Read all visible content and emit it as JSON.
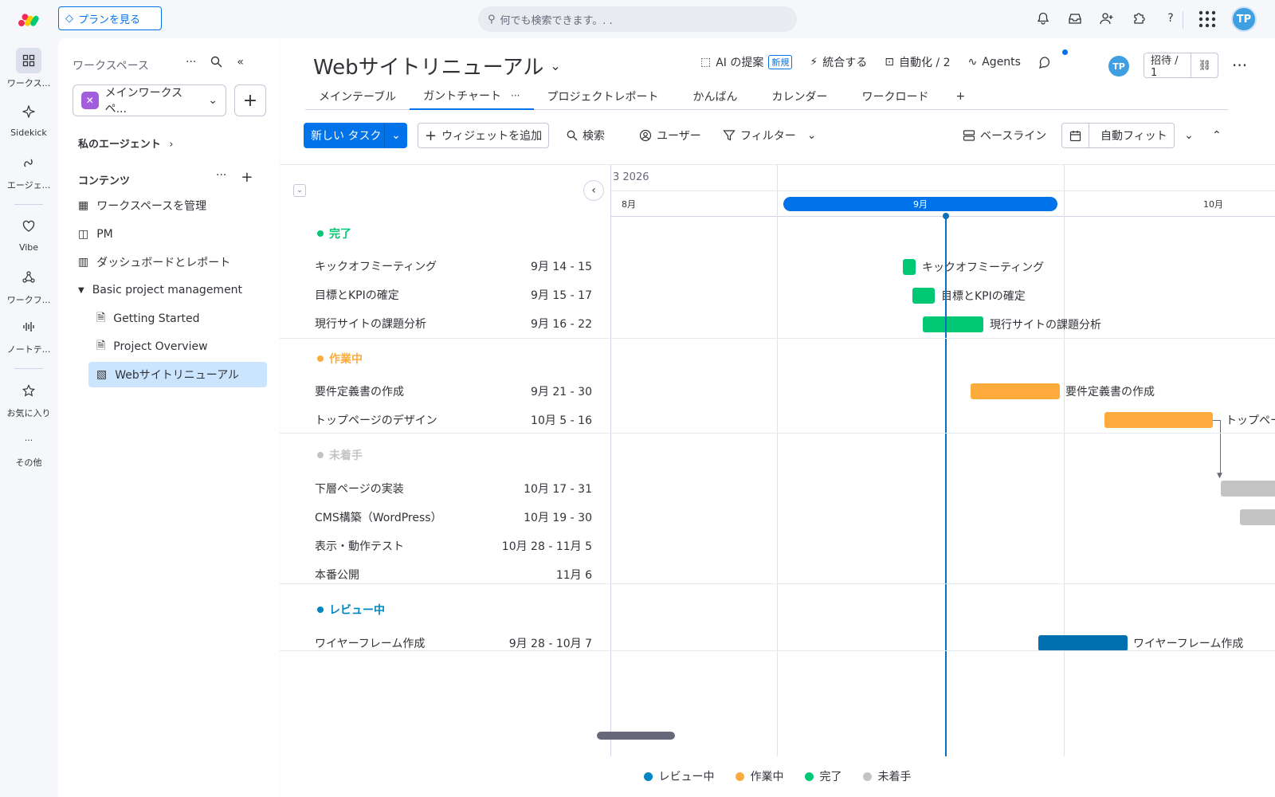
{
  "topbar": {
    "plan_label": "プランを見る",
    "search_placeholder": "何でも検索できます。. .",
    "avatar": "TP"
  },
  "rail": {
    "items": [
      {
        "label": "ワークス..."
      },
      {
        "label": "Sidekick"
      },
      {
        "label": "エージェ..."
      },
      {
        "label": "Vibe"
      },
      {
        "label": "ワークフ..."
      },
      {
        "label": "ノートテ..."
      },
      {
        "label": "お気に入り"
      },
      {
        "label": "その他"
      }
    ]
  },
  "sidebar": {
    "heading": "ワークスペース",
    "workspace_name": "メインワークスペ...",
    "my_agents": "私のエージェント",
    "content_label": "コンテンツ",
    "items": [
      {
        "label": "ワークスペースを管理"
      },
      {
        "label": "PM"
      },
      {
        "label": "ダッシュボードとレポート"
      },
      {
        "label": "Basic project management"
      },
      {
        "label": "Getting Started"
      },
      {
        "label": "Project Overview"
      },
      {
        "label": "Webサイトリニューアル"
      }
    ]
  },
  "board": {
    "title": "Webサイトリニューアル",
    "ai_label": "AI の提案",
    "new_badge": "新規",
    "integrate": "統合する",
    "automation": "自動化 / 2",
    "agents": "Agents",
    "avatar": "TP",
    "invite": "招待 / 1",
    "tabs": [
      {
        "label": "メインテーブル"
      },
      {
        "label": "ガントチャート"
      },
      {
        "label": "プロジェクトレポート"
      },
      {
        "label": "かんばん"
      },
      {
        "label": "カレンダー"
      },
      {
        "label": "ワークロード"
      }
    ],
    "add_tab": "+"
  },
  "toolbar": {
    "new_task": "新しい タスク",
    "add_widget": "ウィジェットを追加",
    "search": "検索",
    "user": "ユーザー",
    "filter": "フィルター",
    "baseline": "ベースライン",
    "autofit": "自動フィット"
  },
  "gantt": {
    "year": "3 2026",
    "months": {
      "aug": "8月",
      "sep": "9月",
      "oct": "10月"
    },
    "groups": [
      {
        "name": "完了",
        "color": "#00c875"
      },
      {
        "name": "作業中",
        "color": "#fdab3d"
      },
      {
        "name": "未着手",
        "color": "#c4c4c4"
      },
      {
        "name": "レビュー中",
        "color": "#0086c0"
      }
    ],
    "tasks": [
      {
        "name": "キックオフミーティング",
        "date": "9月 14 - 15",
        "bar_label": "キックオフミーティング"
      },
      {
        "name": "目標とKPIの確定",
        "date": "9月 15 - 17",
        "bar_label": "目標とKPIの確定"
      },
      {
        "name": "現行サイトの課題分析",
        "date": "9月 16 - 22",
        "bar_label": "現行サイトの課題分析"
      },
      {
        "name": "要件定義書の作成",
        "date": "9月 21 - 30",
        "bar_label": "要件定義書の作成"
      },
      {
        "name": "トップページのデザイン",
        "date": "10月 5 - 16",
        "bar_label": "トップペー"
      },
      {
        "name": "下層ページの実装",
        "date": "10月 17 - 31",
        "bar_label": ""
      },
      {
        "name": "CMS構築（WordPress）",
        "date": "10月 19 - 30",
        "bar_label": ""
      },
      {
        "name": "表示・動作テスト",
        "date": "10月 28 - 11月 5",
        "bar_label": ""
      },
      {
        "name": "本番公開",
        "date": "11月 6",
        "bar_label": ""
      },
      {
        "name": "ワイヤーフレーム作成",
        "date": "9月 28 - 10月 7",
        "bar_label": "ワイヤーフレーム作成"
      }
    ],
    "legend": [
      {
        "label": "レビュー中",
        "color": "#0086c0"
      },
      {
        "label": "作業中",
        "color": "#fdab3d"
      },
      {
        "label": "完了",
        "color": "#00c875"
      },
      {
        "label": "未着手",
        "color": "#c4c4c4"
      }
    ]
  }
}
